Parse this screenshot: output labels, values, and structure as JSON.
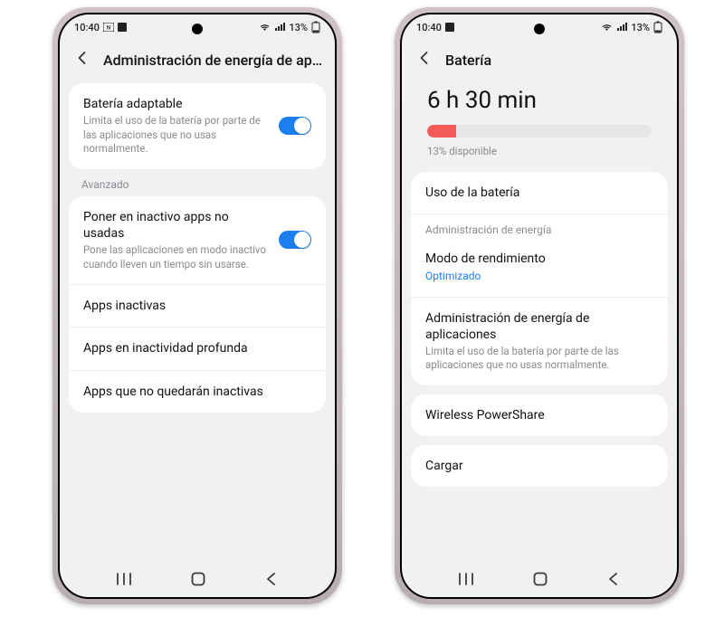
{
  "status": {
    "time": "10:40",
    "battery_pct": "13%"
  },
  "left": {
    "title": "Administración de energía de aplic…",
    "adaptive": {
      "title": "Batería adaptable",
      "sub": "Limita el uso de la batería por parte de las aplicaciones que no usas normalmente."
    },
    "advanced_label": "Avanzado",
    "sleep_unused": {
      "title": "Poner en inactivo apps no usadas",
      "sub": "Pone las aplicaciones en modo inactivo cuando lleven un tiempo sin usarse."
    },
    "rows": {
      "inactive": "Apps inactivas",
      "deep": "Apps en inactividad profunda",
      "never": "Apps que no quedarán inactivas"
    }
  },
  "right": {
    "title": "Batería",
    "time_remaining": "6 h 30 min",
    "pct_available": "13% disponible",
    "bar_pct": 13,
    "usage_row": "Uso de la batería",
    "mgmt_label": "Administración de energía",
    "perf": {
      "title": "Modo de rendimiento",
      "value": "Optimizado"
    },
    "app_power": {
      "title": "Administración de energía de aplicaciones",
      "sub": "Limita el uso de la batería por parte de las aplicaciones que no usas normalmente."
    },
    "wireless": "Wireless PowerShare",
    "charge": "Cargar"
  }
}
